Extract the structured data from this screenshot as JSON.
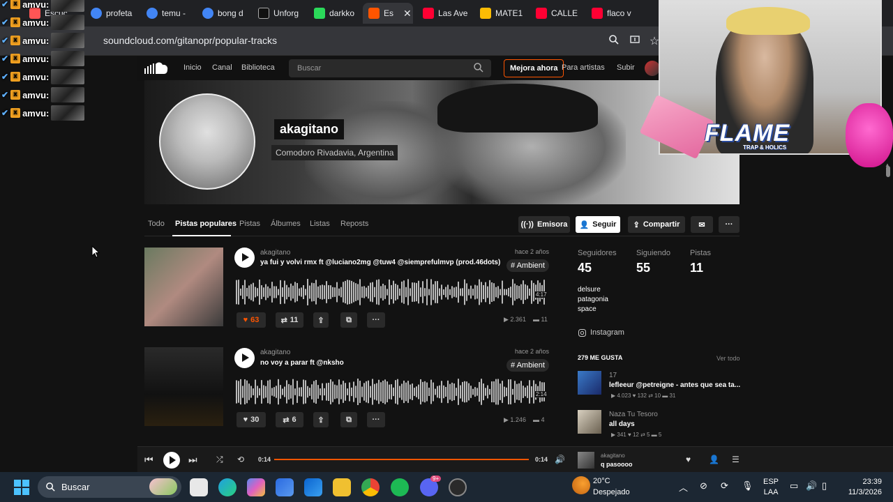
{
  "browser": {
    "tabs": [
      {
        "label": "Escuc",
        "color": "#f55"
      },
      {
        "label": "profeta",
        "color": "#4285f4"
      },
      {
        "label": "temu -",
        "color": "#4285f4"
      },
      {
        "label": "bong d",
        "color": "#4285f4"
      },
      {
        "label": "Unforg",
        "color": "#222"
      },
      {
        "label": "darkko",
        "color": "#2bd95a"
      },
      {
        "label": "Es",
        "color": "#ff5500"
      },
      {
        "label": "Las Ave",
        "color": "#ff0033"
      },
      {
        "label": "MATE1",
        "color": "#fbbc04"
      },
      {
        "label": "CALLE",
        "color": "#ff0033"
      },
      {
        "label": "flaco v",
        "color": "#ff0033"
      }
    ],
    "active_tab_close": "✕",
    "url": "soundcloud.com/gitanopr/popular-tracks"
  },
  "chat": {
    "username": "amvu:",
    "count": 7
  },
  "nav": {
    "home": "Inicio",
    "feed": "Canal",
    "library": "Biblioteca",
    "search_placeholder": "Buscar",
    "upgrade": "Mejora ahora",
    "for_artists": "Para artistas",
    "upload": "Subir"
  },
  "profile": {
    "username": "akagitano",
    "location": "Comodoro Rivadavia, Argentina",
    "tabs": [
      "Todo",
      "Pistas populares",
      "Pistas",
      "Álbumes",
      "Listas",
      "Reposts"
    ],
    "active_tab": "Pistas populares",
    "station": "Emisora",
    "follow": "Seguir",
    "share": "Compartir"
  },
  "tracks": [
    {
      "user": "akagitano",
      "title": "ya fui y volvi rmx ft @luciano2mg @tuw4 @siempreful​mvp (prod.46dots)",
      "date": "hace 2 años",
      "tag": "# Ambient",
      "duration": "4:17",
      "likes": "63",
      "reposts": "11",
      "plays": "2.361",
      "comments": "11"
    },
    {
      "user": "akagitano",
      "title": "no voy a parar ft @nksho",
      "date": "hace 2 años",
      "tag": "# Ambient",
      "duration": "2:14",
      "likes": "30",
      "reposts": "6",
      "plays": "1.246",
      "comments": "4"
    }
  ],
  "sidebar": {
    "followers_label": "Seguidores",
    "followers": "45",
    "following_label": "Siguiendo",
    "following": "55",
    "tracks_label": "Pistas",
    "tracks": "11",
    "bio": [
      "delsure",
      "patagonia",
      "space"
    ],
    "instagram": "Instagram",
    "likes_heading": "279 ME GUSTA",
    "view_all": "Ver todo",
    "liked": [
      {
        "user": "17",
        "title": "lefleeur @petreigne - antes que sea ta...",
        "plays": "4.023",
        "likes": "132",
        "reposts": "10",
        "comments": "31"
      },
      {
        "user": "Naza Tu Tesoro",
        "title": "all days",
        "plays": "341",
        "likes": "12",
        "reposts": "5",
        "comments": "5"
      }
    ]
  },
  "player": {
    "current": "0:14",
    "total": "0:14",
    "artist": "akagitano",
    "title": "q pasoooo"
  },
  "taskbar": {
    "search": "Buscar",
    "temp": "20°C",
    "weather": "Despejado",
    "lang1": "ESP",
    "lang2": "LAA",
    "time": "23:39",
    "date": "11/3/2026",
    "notification_badge": "9+"
  },
  "overlay": {
    "flame": "FLAME",
    "flame_sub": "TRAP & HOLICS"
  }
}
